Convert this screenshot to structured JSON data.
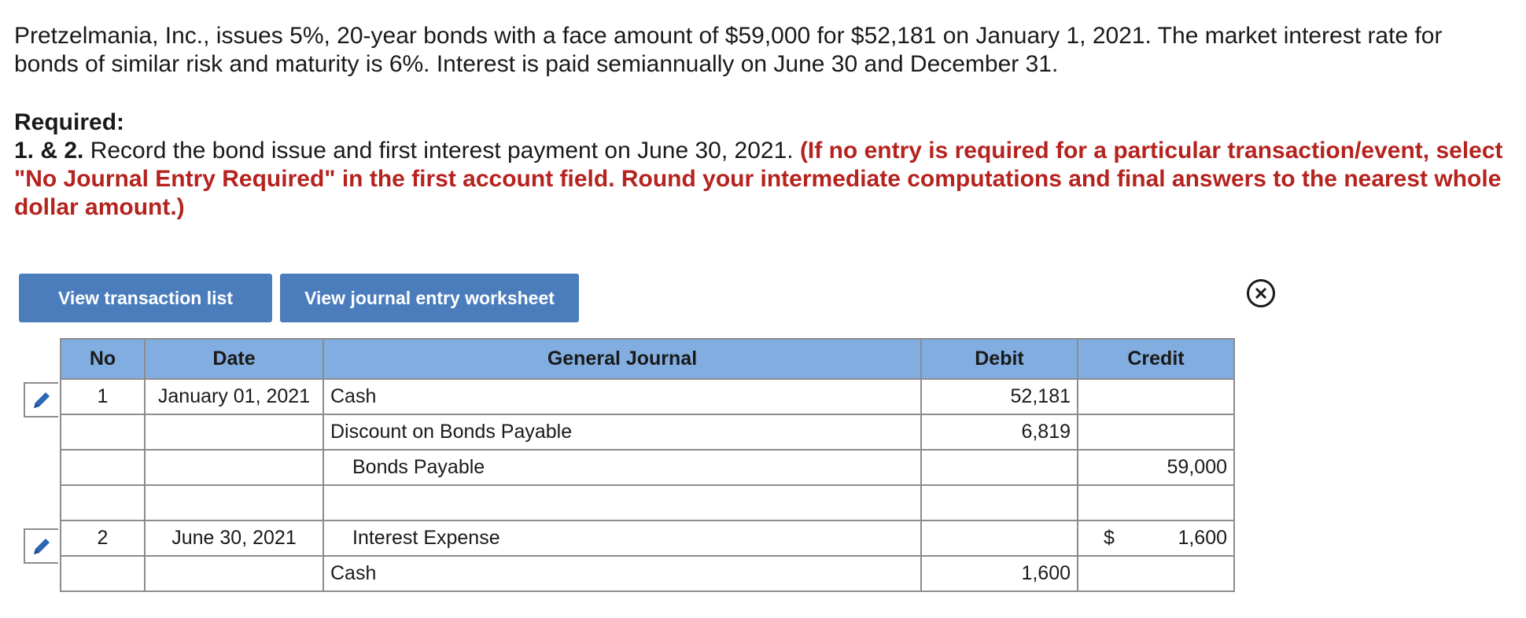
{
  "problem": {
    "text": "Pretzelmania, Inc., issues 5%, 20-year bonds with a face amount of $59,000 for $52,181 on January 1, 2021. The market interest rate for bonds of similar risk and maturity is 6%. Interest is paid semiannually on June 30 and December 31."
  },
  "required": {
    "heading": "Required:",
    "number": "1. & 2.",
    "prompt": " Record the bond issue and first interest payment on June 30, 2021. ",
    "instructions": "(If no entry is required for a particular transaction/event, select \"No Journal Entry Required\" in the first account field. Round your intermediate computations and final answers to the nearest whole dollar amount.)"
  },
  "buttons": {
    "view_transactions": "View transaction list",
    "view_worksheet": "View journal entry worksheet"
  },
  "icons": {
    "edit": "pencil-icon",
    "close": "close-circle-icon"
  },
  "colors": {
    "button": "#4b7dbd",
    "header": "#82ade0",
    "instruction_red": "#b5231f"
  },
  "journal": {
    "headers": {
      "no": "No",
      "date": "Date",
      "account": "General Journal",
      "debit": "Debit",
      "credit": "Credit"
    },
    "rows": [
      {
        "no": "1",
        "date": "January 01, 2021",
        "account": "Cash",
        "debit": "52,181",
        "credit": "",
        "dollar": ""
      },
      {
        "no": "",
        "date": "",
        "account": "Discount on Bonds Payable",
        "debit": "6,819",
        "credit": "",
        "dollar": ""
      },
      {
        "no": "",
        "date": "",
        "account": "Bonds Payable",
        "debit": "",
        "credit": "59,000",
        "dollar": ""
      },
      {
        "no": "",
        "date": "",
        "account": "",
        "debit": "",
        "credit": "",
        "dollar": ""
      },
      {
        "no": "2",
        "date": "June 30, 2021",
        "account": "Interest Expense",
        "debit": "",
        "credit": "1,600",
        "dollar": "$"
      },
      {
        "no": "",
        "date": "",
        "account": "Cash",
        "debit": "1,600",
        "credit": "",
        "dollar": ""
      }
    ]
  }
}
